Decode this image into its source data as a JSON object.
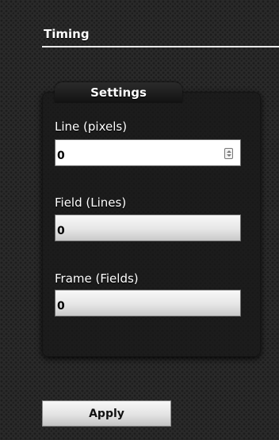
{
  "section": {
    "title": "Timing"
  },
  "panel": {
    "title": "Settings"
  },
  "fields": [
    {
      "label": "Line (pixels)",
      "value": "0",
      "state": "active"
    },
    {
      "label": "Field (Lines)",
      "value": "0",
      "state": "disabled"
    },
    {
      "label": "Frame (Fields)",
      "value": "0",
      "state": "disabled"
    }
  ],
  "icons": {
    "stepper": "spin-stepper-icon"
  },
  "actions": {
    "apply_label": "Apply"
  }
}
